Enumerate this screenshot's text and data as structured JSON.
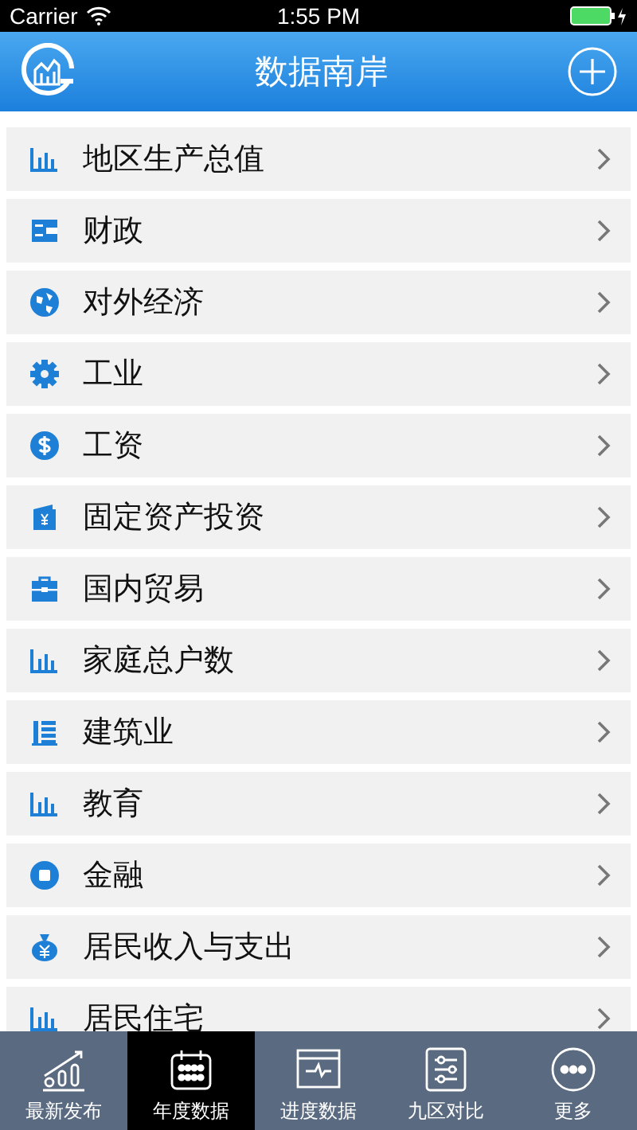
{
  "status_bar": {
    "carrier": "Carrier",
    "time": "1:55 PM"
  },
  "header": {
    "title": "数据南岸"
  },
  "items": [
    {
      "label": "地区生产总值",
      "kind": "bars"
    },
    {
      "label": "财政",
      "kind": "wallet"
    },
    {
      "label": "对外经济",
      "kind": "globe"
    },
    {
      "label": "工业",
      "kind": "gear"
    },
    {
      "label": "工资",
      "kind": "dollar"
    },
    {
      "label": "固定资产投资",
      "kind": "yen"
    },
    {
      "label": "国内贸易",
      "kind": "briefcase"
    },
    {
      "label": "家庭总户数",
      "kind": "bars"
    },
    {
      "label": "建筑业",
      "kind": "list"
    },
    {
      "label": "教育",
      "kind": "bars"
    },
    {
      "label": "金融",
      "kind": "stop"
    },
    {
      "label": "居民收入与支出",
      "kind": "moneybag"
    },
    {
      "label": "居民住宅",
      "kind": "bars"
    }
  ],
  "tabs": [
    {
      "label": "最新发布",
      "kind": "trend",
      "selected": false
    },
    {
      "label": "年度数据",
      "kind": "calendar",
      "selected": true
    },
    {
      "label": "进度数据",
      "kind": "pulse",
      "selected": false
    },
    {
      "label": "九区对比",
      "kind": "sliders",
      "selected": false
    },
    {
      "label": "更多",
      "kind": "more",
      "selected": false
    }
  ]
}
